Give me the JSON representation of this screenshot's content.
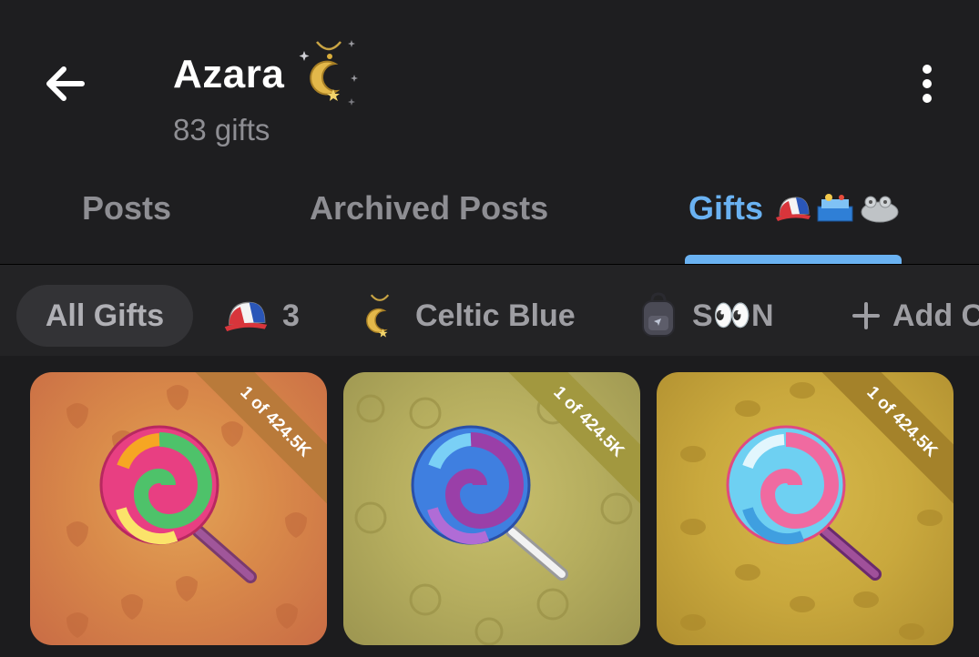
{
  "header": {
    "title": "Azara",
    "subtitle": "83 gifts",
    "back_icon": "arrow-left-icon",
    "menu_icon": "more-vertical-icon",
    "title_emoji": "moon-pendant-icon"
  },
  "tabs": [
    {
      "label": "Posts",
      "active": false
    },
    {
      "label": "Archived Posts",
      "active": false
    },
    {
      "label": "Gifts",
      "active": true,
      "icons": [
        "cap-icon",
        "toy-box-icon",
        "frog-icon"
      ]
    }
  ],
  "filters": {
    "all": "All Gifts",
    "cap_count": "3",
    "celtic": "Celtic Blue",
    "soon": "S👀N",
    "add": "Add C"
  },
  "gifts": [
    {
      "badge": "1 of 424.5K",
      "background": "#d98a4a",
      "pattern": "acorn-icon"
    },
    {
      "badge": "1 of 424.5K",
      "background": "#b5ad5e",
      "pattern": "celtic-knot-icon"
    },
    {
      "badge": "1 of 424.5K",
      "background": "#c9a83d",
      "pattern": "crab-icon"
    }
  ],
  "colors": {
    "accent": "#6ab2f2",
    "background": "#1c1c1e",
    "muted_text": "#8e8e93"
  }
}
